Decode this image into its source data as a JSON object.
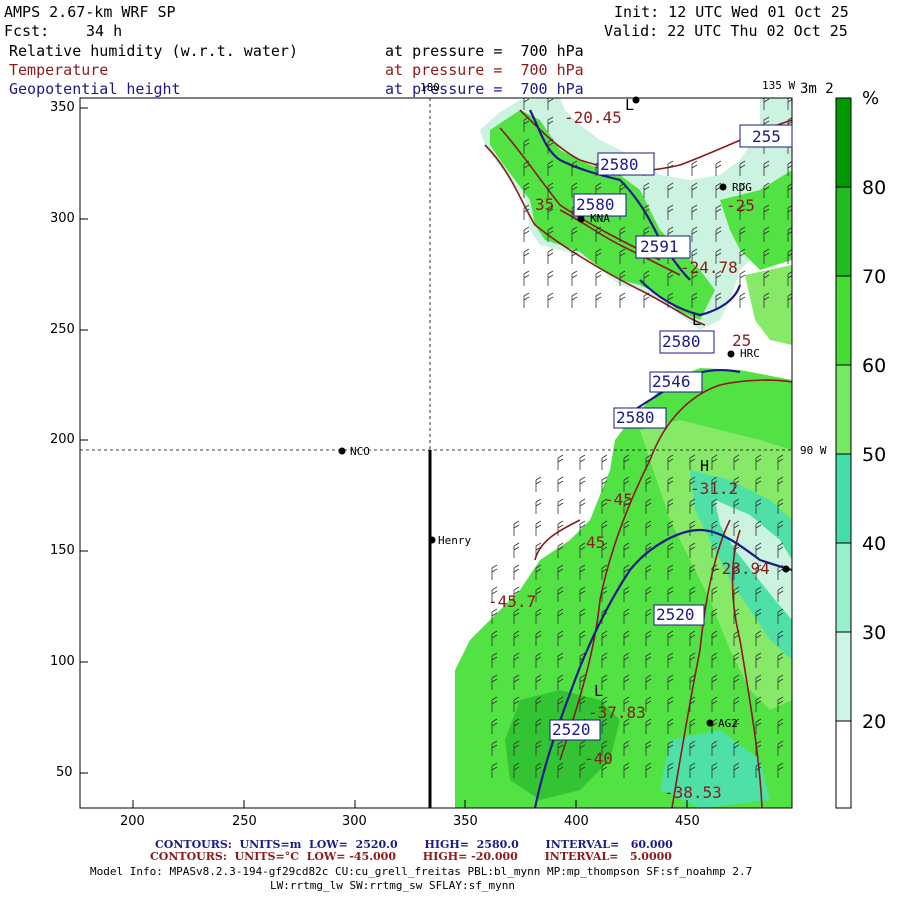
{
  "header": {
    "model": "AMPS 2.67-km WRF SP",
    "fcst_label": "Fcst:",
    "fcst_value": "34 h",
    "init": "Init: 12 UTC Wed 01 Oct 25",
    "valid": "Valid: 22 UTC Thu 02 Oct 25",
    "fields": [
      {
        "name": "Relative humidity (w.r.t. water)",
        "level": "at pressure =  700 hPa",
        "color": "#000000"
      },
      {
        "name": "Temperature",
        "level": "at pressure =  700 hPa",
        "color": "#8b1a1a"
      },
      {
        "name": "Geopotential height",
        "level": "at pressure =  700 hPa",
        "color": "#1a1a8b"
      }
    ]
  },
  "map": {
    "x_ticks": [
      "200",
      "250",
      "300",
      "350",
      "400",
      "450"
    ],
    "y_ticks": [
      "350",
      "300",
      "250",
      "200",
      "150",
      "100",
      "50"
    ],
    "meridian_labels": [
      "180",
      "135 W",
      "90 W"
    ],
    "corner_label": "3m 2",
    "stations": [
      "RDG",
      "KNA",
      "HRC",
      "NCO",
      "Henry",
      "AG2"
    ],
    "height_contour_labels": [
      "2580",
      "2580",
      "2591",
      "2580",
      "2546",
      "2580",
      "2520",
      "2520",
      "255"
    ],
    "temp_labels": [
      "-20.45",
      "-25",
      "35",
      "-24.78",
      "25",
      "-45",
      "-31.2",
      "45",
      "-45.7",
      "-28.94",
      "-37.83",
      "-40",
      "-38.53"
    ],
    "extrema_marks": [
      "L",
      "L",
      "H",
      "L"
    ],
    "colors": {
      "rh_light": "#ccf2e0",
      "rh_teal": "#4fe0a8",
      "rh_green1": "#86ea68",
      "rh_green2": "#52e244",
      "rh_green3": "#33c433",
      "temp": "#8b1a1a",
      "height": "#1a1a8b"
    }
  },
  "colorbar": {
    "unit": "%",
    "labels": [
      "80",
      "70",
      "60",
      "50",
      "40",
      "30",
      "20"
    ],
    "colors": [
      "#009900",
      "#22bb22",
      "#44dd33",
      "#77e866",
      "#44ddaa",
      "#99eecc",
      "#ccf5e5",
      "#ffffff"
    ]
  },
  "footer": {
    "line1": "CONTOURS:  UNITS=m  LOW=  2520.0       HIGH=  2580.0       INTERVAL=   60.000",
    "line2": "CONTOURS:  UNITS=°C  LOW= -45.000       HIGH= -20.000       INTERVAL=   5.0000",
    "model_info": "Model Info: MPASv8.2.3-194-gf29cd82c CU:cu_grell_freitas PBL:bl_mynn MP:mp_thompson SF:sf_noahmp 2.7",
    "model_info2": "LW:rrtmg_lw SW:rrtmg_sw SFLAY:sf_mynn"
  }
}
